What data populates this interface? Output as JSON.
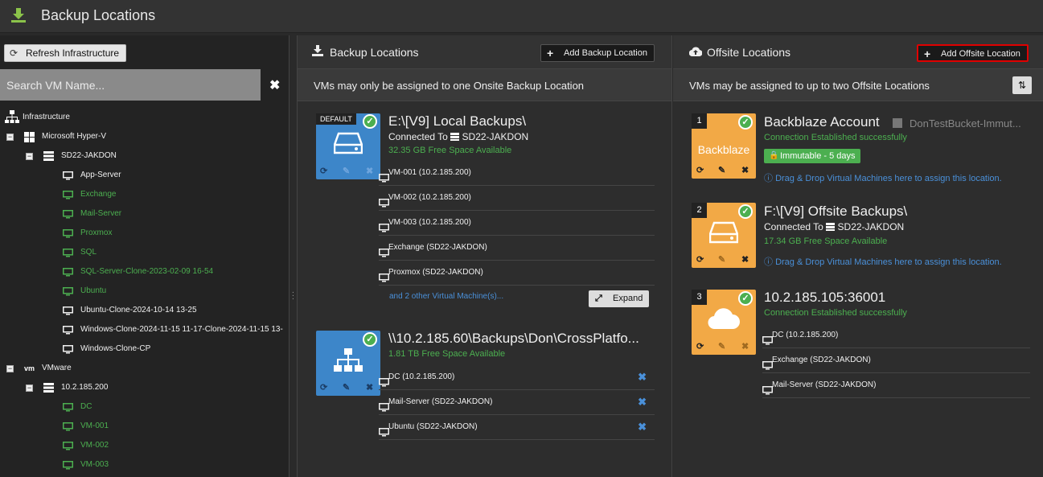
{
  "app": {
    "title": "Backup Locations"
  },
  "left": {
    "refresh_label": "Refresh Infrastructure",
    "search_placeholder": "Search VM Name...",
    "tree": {
      "root": "Infrastructure",
      "hyperv": "Microsoft Hyper-V",
      "hyperv_host": "SD22-JAKDON",
      "hyperv_vms": [
        {
          "name": "App-Server",
          "state": "white"
        },
        {
          "name": "Exchange",
          "state": "green"
        },
        {
          "name": "Mail-Server",
          "state": "green"
        },
        {
          "name": "Proxmox",
          "state": "green"
        },
        {
          "name": "SQL",
          "state": "green"
        },
        {
          "name": "SQL-Server-Clone-2023-02-09 16-54",
          "state": "green"
        },
        {
          "name": "Ubuntu",
          "state": "green"
        },
        {
          "name": "Ubuntu-Clone-2024-10-14 13-25",
          "state": "white"
        },
        {
          "name": "Windows-Clone-2024-11-15 11-17-Clone-2024-11-15 13-",
          "state": "white"
        },
        {
          "name": "Windows-Clone-CP",
          "state": "white"
        }
      ],
      "vmware": "VMware",
      "vmware_host": "10.2.185.200",
      "vmware_vms": [
        {
          "name": "DC",
          "state": "green"
        },
        {
          "name": "VM-001",
          "state": "green"
        },
        {
          "name": "VM-002",
          "state": "green"
        },
        {
          "name": "VM-003",
          "state": "green"
        }
      ]
    }
  },
  "center": {
    "title": "Backup Locations",
    "add_label": "Add Backup Location",
    "note": "VMs may only be assigned to one Onsite Backup Location",
    "loc1": {
      "badge": "DEFAULT",
      "title": "E:\\[V9] Local Backups\\",
      "connected_prefix": "Connected To",
      "host": "SD22-JAKDON",
      "free": "32.35 GB Free Space Available",
      "vms": [
        "VM-001 (10.2.185.200)",
        "VM-002 (10.2.185.200)",
        "VM-003 (10.2.185.200)",
        "Exchange (SD22-JAKDON)",
        "Proxmox (SD22-JAKDON)"
      ],
      "more": "and 2 other Virtual Machine(s)...",
      "expand_label": "Expand"
    },
    "loc2": {
      "title": "\\\\10.2.185.60\\Backups\\Don\\CrossPlatfo...",
      "free": "1.81 TB Free Space Available",
      "vms": [
        "DC (10.2.185.200)",
        "Mail-Server (SD22-JAKDON)",
        "Ubuntu (SD22-JAKDON)"
      ]
    }
  },
  "right": {
    "title": "Offsite Locations",
    "add_label": "Add Offsite Location",
    "note": "VMs may be assigned to up to two Offsite Locations",
    "loc1": {
      "num": "1",
      "tile_text": "Backblaze",
      "title": "Backblaze Account",
      "bucket": "DonTestBucket-Immut...",
      "status": "Connection Established successfully",
      "immutable": "Immutable - 5 days",
      "hint": "Drag & Drop Virtual Machines here to assign this location."
    },
    "loc2": {
      "num": "2",
      "title": "F:\\[V9] Offsite Backups\\",
      "connected_prefix": "Connected To",
      "host": "SD22-JAKDON",
      "free": "17.34 GB Free Space Available",
      "hint": "Drag & Drop Virtual Machines here to assign this location."
    },
    "loc3": {
      "num": "3",
      "title": "10.2.185.105:36001",
      "status": "Connection Established successfully",
      "vms": [
        "DC (10.2.185.200)",
        "Exchange (SD22-JAKDON)",
        "Mail-Server (SD22-JAKDON)"
      ]
    }
  },
  "colors": {
    "accent_green": "#4caf50",
    "tile_blue": "#3d86c9",
    "tile_orange": "#f2a946",
    "link_blue": "#4a90d9"
  }
}
